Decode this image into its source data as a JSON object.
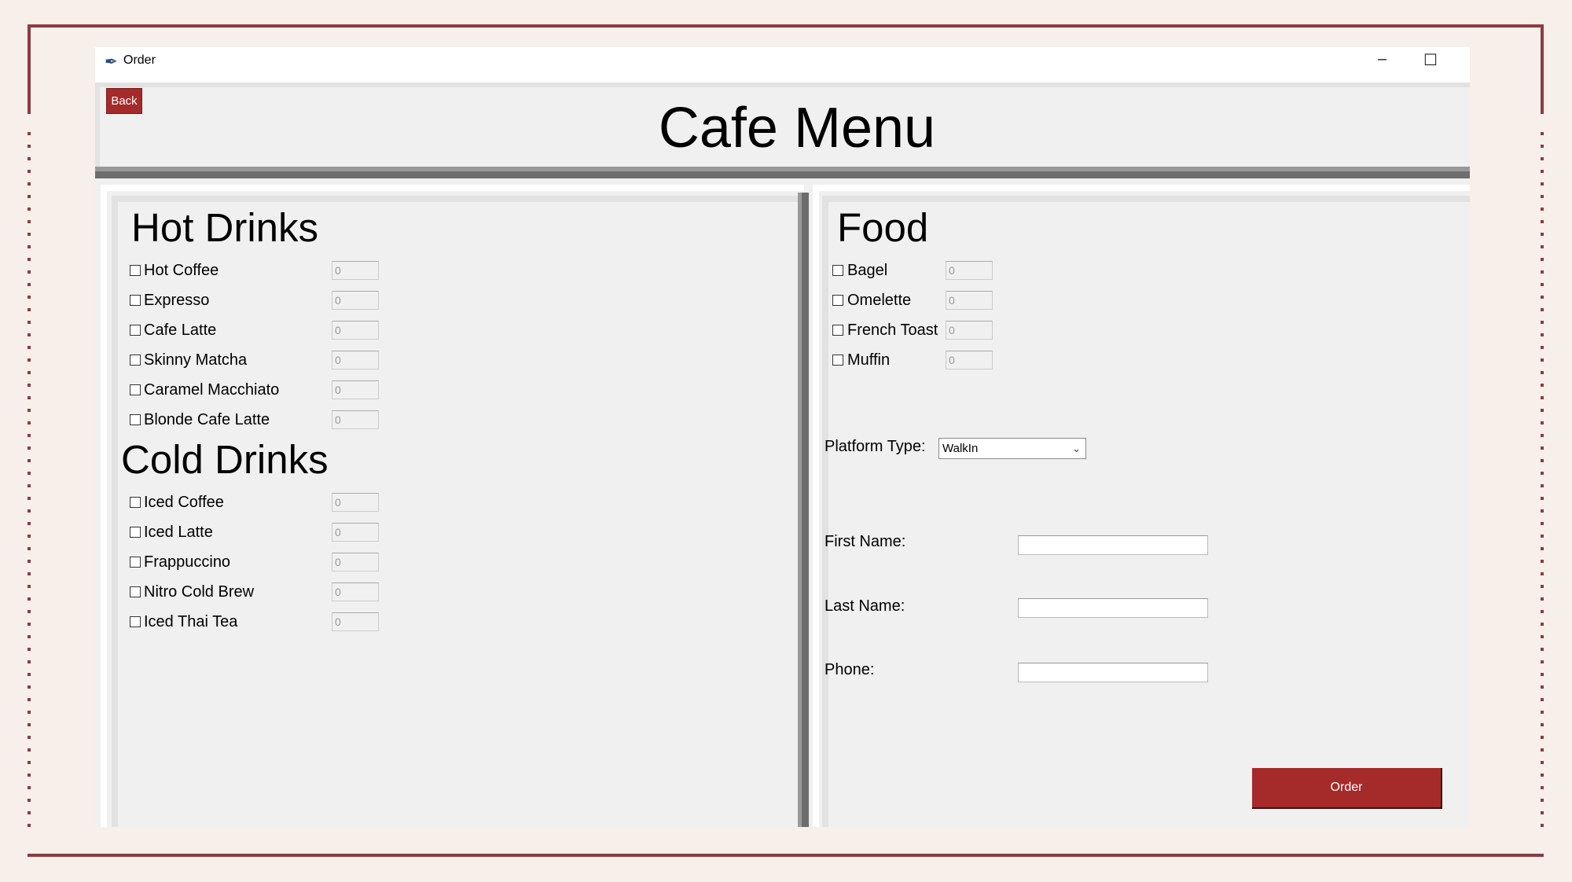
{
  "window": {
    "title": "Order",
    "icon": "feather-icon",
    "minimize_icon": "–",
    "maximize_icon": "☐"
  },
  "header": {
    "back_label": "Back",
    "title": "Cafe Menu"
  },
  "hot_drinks": {
    "heading": "Hot Drinks",
    "items": [
      {
        "label": "Hot Coffee",
        "qty": "0",
        "checked": false
      },
      {
        "label": "Expresso",
        "qty": "0",
        "checked": false
      },
      {
        "label": "Cafe Latte",
        "qty": "0",
        "checked": false
      },
      {
        "label": "Skinny Matcha",
        "qty": "0",
        "checked": false
      },
      {
        "label": "Caramel Macchiato",
        "qty": "0",
        "checked": false
      },
      {
        "label": "Blonde Cafe Latte",
        "qty": "0",
        "checked": false
      }
    ]
  },
  "cold_drinks": {
    "heading": "Cold Drinks",
    "items": [
      {
        "label": "Iced Coffee",
        "qty": "0",
        "checked": false
      },
      {
        "label": "Iced Latte",
        "qty": "0",
        "checked": false
      },
      {
        "label": "Frappuccino",
        "qty": "0",
        "checked": false
      },
      {
        "label": "Nitro Cold Brew",
        "qty": "0",
        "checked": false
      },
      {
        "label": "Iced Thai Tea",
        "qty": "0",
        "checked": false
      }
    ]
  },
  "food": {
    "heading": "Food",
    "items": [
      {
        "label": "Bagel",
        "qty": "0",
        "checked": false
      },
      {
        "label": "Omelette",
        "qty": "0",
        "checked": false
      },
      {
        "label": "French Toast",
        "qty": "0",
        "checked": false
      },
      {
        "label": "Muffin",
        "qty": "0",
        "checked": false
      }
    ]
  },
  "form": {
    "platform_label": "Platform Type:",
    "platform_value": "WalkIn",
    "first_name_label": "First Name:",
    "first_name_value": "",
    "last_name_label": "Last Name:",
    "last_name_value": "",
    "phone_label": "Phone:",
    "phone_value": "",
    "order_label": "Order"
  },
  "colors": {
    "accent": "#a52a2a",
    "frame": "#8c3b43",
    "background": "#f7efe9"
  }
}
